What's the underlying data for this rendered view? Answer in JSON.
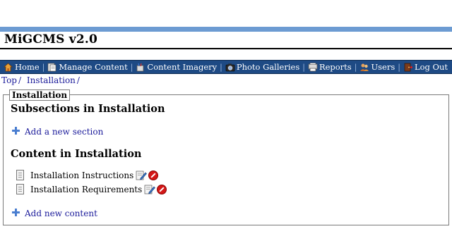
{
  "app": {
    "title": "MiGCMS v2.0"
  },
  "nav": {
    "items": [
      {
        "label": "Home",
        "icon": "home-icon"
      },
      {
        "label": "Manage Content",
        "icon": "manage-content-icon"
      },
      {
        "label": "Content Imagery",
        "icon": "content-imagery-icon"
      },
      {
        "label": "Photo Galleries",
        "icon": "camera-icon"
      },
      {
        "label": "Reports",
        "icon": "reports-icon"
      },
      {
        "label": "Users",
        "icon": "users-icon"
      },
      {
        "label": "Log Out",
        "icon": "logout-icon"
      }
    ]
  },
  "breadcrumb": {
    "items": [
      "Top",
      "Installation"
    ]
  },
  "panel": {
    "legend": "Installation",
    "subsections_heading": "Subsections in Installation",
    "add_section_label": "Add a new section",
    "content_heading": "Content in Installation",
    "content_items": [
      "Installation Instructions",
      "Installation Requirements"
    ],
    "add_content_label": "Add new content"
  },
  "colors": {
    "accent_bar": "#6c9bd2",
    "nav_background": "#1e4a84",
    "link": "#1a1a9a",
    "delete": "#d41818"
  }
}
